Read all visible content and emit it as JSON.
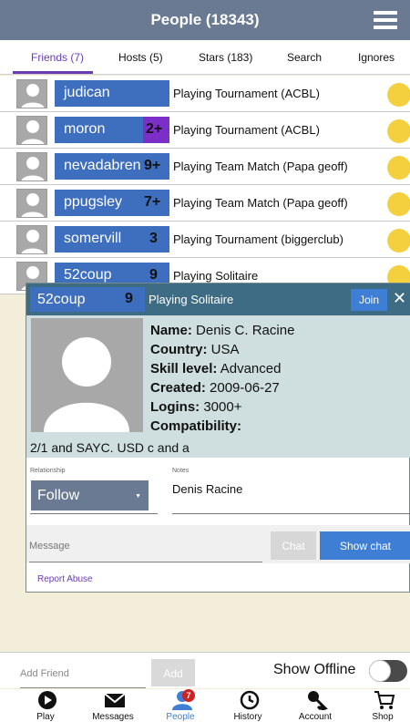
{
  "header": {
    "title": "People (18343)"
  },
  "tabs": [
    {
      "label": "Friends (7)",
      "active": true
    },
    {
      "label": "Hosts (5)"
    },
    {
      "label": "Stars (183)"
    },
    {
      "label": "Search"
    },
    {
      "label": "Ignores"
    }
  ],
  "rows": [
    {
      "name": "judican",
      "badge": "",
      "status": "Playing Tournament (ACBL)"
    },
    {
      "name": "moron",
      "badge": "2+",
      "status": "Playing Tournament (ACBL)"
    },
    {
      "name": "nevadabren",
      "badge": "9+",
      "status": "Playing Team Match (Papa geoff)"
    },
    {
      "name": "ppugsley",
      "badge": "7+",
      "status": "Playing Team Match (Papa geoff)"
    },
    {
      "name": "somervill",
      "badge": "3",
      "status": "Playing Tournament (biggerclub)"
    },
    {
      "name": "52coup",
      "badge": "9",
      "status": "Playing Solitaire"
    }
  ],
  "dialog": {
    "name": "52coup",
    "badge": "9",
    "status": "Playing Solitaire",
    "join_label": "Join",
    "close_label": "✕",
    "name_label": "Name:",
    "name_value": "Denis C. Racine",
    "country_label": "Country:",
    "country_value": "USA",
    "skill_label": "Skill level:",
    "skill_value": "Advanced",
    "created_label": "Created:",
    "created_value": "2009-06-27",
    "logins_label": "Logins:",
    "logins_value": "3000+",
    "compat_label": "Compatibility:",
    "compat_value": "2/1 and SAYC. USD c and a",
    "relationship_label": "Relationship",
    "relationship_value": "Follow",
    "notes_label": "Notes",
    "notes_value": "Denis Racine",
    "message_placeholder": "Message",
    "chat_label": "Chat",
    "show_chat_label": "Show chat",
    "report_label": "Report Abuse"
  },
  "add_bar": {
    "add_placeholder": "Add Friend",
    "add_label": "Add",
    "show_offline_label": "Show Offline",
    "show_offline_on": false
  },
  "nav": [
    {
      "label": "Play",
      "icon": "play-icon"
    },
    {
      "label": "Messages",
      "icon": "envelope-icon"
    },
    {
      "label": "People",
      "icon": "people-icon",
      "active": true,
      "badge": "7"
    },
    {
      "label": "History",
      "icon": "history-icon"
    },
    {
      "label": "Account",
      "icon": "key-icon"
    },
    {
      "label": "Shop",
      "icon": "cart-icon"
    }
  ],
  "colors": {
    "header": "#6a7a92",
    "name_chip": "#3e6fbe",
    "accent": "#6a3cb4",
    "status_dot": "#f4d03f",
    "button": "#3e7ed4"
  }
}
